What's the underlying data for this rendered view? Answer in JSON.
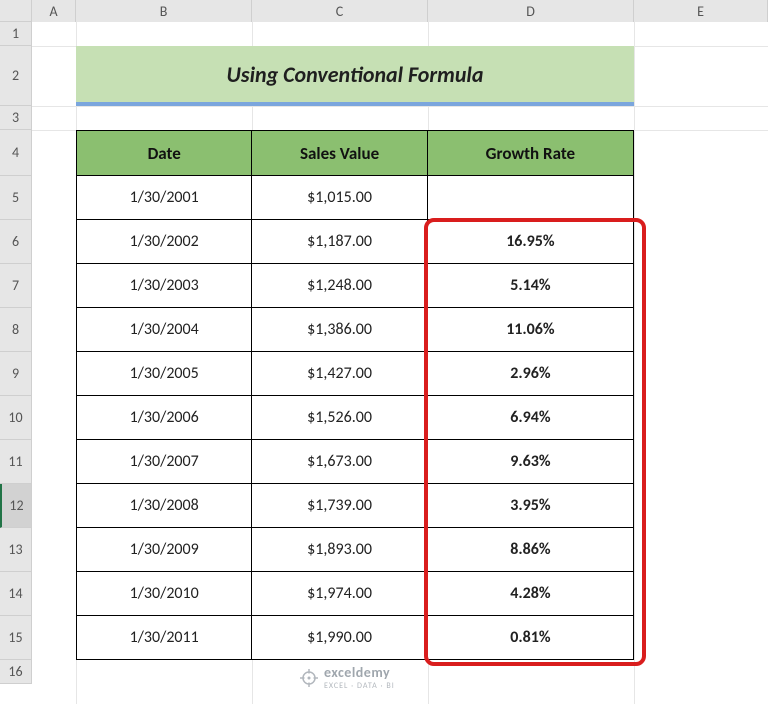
{
  "columns": {
    "A": "A",
    "B": "B",
    "C": "C",
    "D": "D",
    "E": "E"
  },
  "rows": [
    "1",
    "2",
    "3",
    "4",
    "5",
    "6",
    "7",
    "8",
    "9",
    "10",
    "11",
    "12",
    "13",
    "14",
    "15",
    "16"
  ],
  "title": "Using Conventional Formula",
  "headers": {
    "date": "Date",
    "sales": "Sales Value",
    "growth": "Growth Rate"
  },
  "data": [
    {
      "date": "1/30/2001",
      "sales": "$1,015.00",
      "growth": ""
    },
    {
      "date": "1/30/2002",
      "sales": "$1,187.00",
      "growth": "16.95%"
    },
    {
      "date": "1/30/2003",
      "sales": "$1,248.00",
      "growth": "5.14%"
    },
    {
      "date": "1/30/2004",
      "sales": "$1,386.00",
      "growth": "11.06%"
    },
    {
      "date": "1/30/2005",
      "sales": "$1,427.00",
      "growth": "2.96%"
    },
    {
      "date": "1/30/2006",
      "sales": "$1,526.00",
      "growth": "6.94%"
    },
    {
      "date": "1/30/2007",
      "sales": "$1,673.00",
      "growth": "9.63%"
    },
    {
      "date": "1/30/2008",
      "sales": "$1,739.00",
      "growth": "3.95%"
    },
    {
      "date": "1/30/2009",
      "sales": "$1,893.00",
      "growth": "8.86%"
    },
    {
      "date": "1/30/2010",
      "sales": "$1,974.00",
      "growth": "4.28%"
    },
    {
      "date": "1/30/2011",
      "sales": "$1,990.00",
      "growth": "0.81%"
    }
  ],
  "watermark": {
    "name": "exceldemy",
    "tagline": "EXCEL · DATA · BI"
  },
  "selected_row": "12"
}
